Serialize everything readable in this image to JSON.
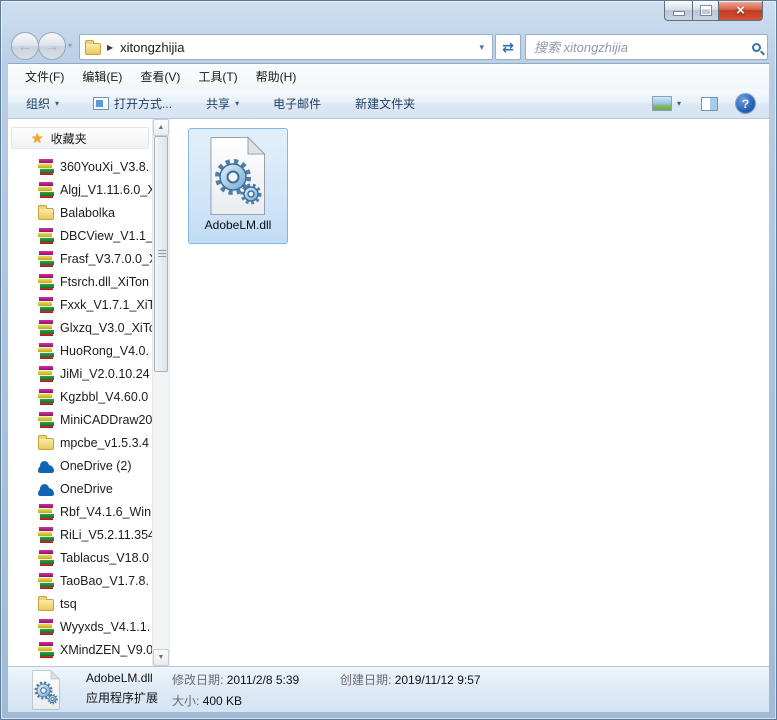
{
  "navbar": {
    "path_folder": "xitongzhijia",
    "search_placeholder": "搜索 xitongzhijia"
  },
  "icons": {
    "back": "←",
    "forward": "→",
    "nav_history_dropdown": "▾",
    "breadcrumb_arrow": "▶",
    "address_dropdown": "▾",
    "refresh": "⇄",
    "organize_dropdown": "▾",
    "share_dropdown": "▾",
    "views_dropdown": "▾",
    "help": "?",
    "favorites_star": "★",
    "scroll_up": "▲",
    "scroll_down": "▼"
  },
  "menubar": {
    "file": "文件(F)",
    "edit": "编辑(E)",
    "view": "查看(V)",
    "tools": "工具(T)",
    "help": "帮助(H)"
  },
  "toolbar": {
    "organize": "组织",
    "open_with": "打开方式...",
    "share": "共享",
    "email": "电子邮件",
    "new_folder": "新建文件夹"
  },
  "sidebar": {
    "favorites": "收藏夹",
    "items": [
      {
        "icon": "rar",
        "label": "360YouXi_V3.8."
      },
      {
        "icon": "rar",
        "label": "Algj_V1.11.6.0_X"
      },
      {
        "icon": "folder",
        "label": "Balabolka"
      },
      {
        "icon": "rar",
        "label": "DBCView_V1.1_"
      },
      {
        "icon": "rar",
        "label": "Frasf_V3.7.0.0_X"
      },
      {
        "icon": "rar",
        "label": "Ftsrch.dll_XiTon"
      },
      {
        "icon": "rar",
        "label": "Fxxk_V1.7.1_XiT"
      },
      {
        "icon": "rar",
        "label": "Glxzq_V3.0_XiTo"
      },
      {
        "icon": "rar",
        "label": "HuoRong_V4.0."
      },
      {
        "icon": "rar",
        "label": "JiMi_V2.0.10.24"
      },
      {
        "icon": "rar",
        "label": "Kgzbbl_V4.60.0"
      },
      {
        "icon": "rar",
        "label": "MiniCADDraw20"
      },
      {
        "icon": "folder",
        "label": "mpcbe_v1.5.3.4"
      },
      {
        "icon": "onedrive",
        "label": "OneDrive (2)"
      },
      {
        "icon": "onedrive",
        "label": "OneDrive"
      },
      {
        "icon": "rar",
        "label": "Rbf_V4.1.6_Win"
      },
      {
        "icon": "rar",
        "label": "RiLi_V5.2.11.354"
      },
      {
        "icon": "rar",
        "label": "Tablacus_V18.0"
      },
      {
        "icon": "rar",
        "label": "TaoBao_V1.7.8."
      },
      {
        "icon": "folder",
        "label": "tsq"
      },
      {
        "icon": "rar",
        "label": "Wyyxds_V4.1.1."
      },
      {
        "icon": "rar",
        "label": "XMindZEN_V9.0"
      }
    ]
  },
  "main": {
    "file_name": "AdobeLM.dll"
  },
  "statusbar": {
    "file_name": "AdobeLM.dll",
    "modified_label": "修改日期:",
    "modified_value": "2011/2/8 5:39",
    "created_label": "创建日期:",
    "created_value": "2019/11/12 9:57",
    "file_type": "应用程序扩展",
    "size_label": "大小:",
    "size_value": "400 KB"
  },
  "colors": {
    "frame_blue": "#abc4dc",
    "close_red": "#c03a20",
    "selection_blue": "#cde3f7",
    "accent_blue": "#2c6cbe"
  }
}
